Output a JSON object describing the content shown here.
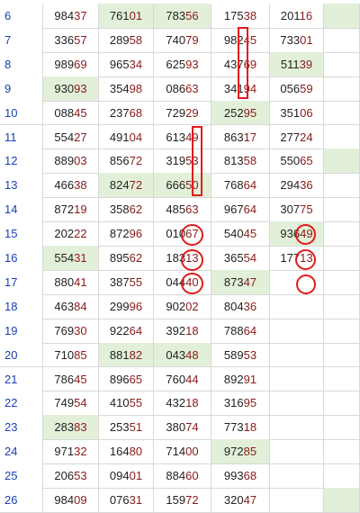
{
  "colors": {
    "highlight": "#e2f0d9",
    "row_number": "#1a3fb0",
    "last_two_digits": "#8b1a1a",
    "annotation": "#e21b1b"
  },
  "rows": [
    {
      "num": "6",
      "cells": [
        [
          "984",
          "37"
        ],
        [
          "761",
          "01"
        ],
        [
          "783",
          "56"
        ],
        [
          "175",
          "38"
        ],
        [
          "201",
          "16"
        ],
        [
          "",
          ""
        ]
      ],
      "hl": [
        1,
        2,
        5
      ]
    },
    {
      "num": "7",
      "cells": [
        [
          "336",
          "57"
        ],
        [
          "289",
          "58"
        ],
        [
          "740",
          "79"
        ],
        [
          "982",
          "45"
        ],
        [
          "733",
          "01"
        ],
        [
          "",
          ""
        ]
      ],
      "hl": []
    },
    {
      "num": "8",
      "cells": [
        [
          "989",
          "69"
        ],
        [
          "965",
          "34"
        ],
        [
          "625",
          "93"
        ],
        [
          "437",
          "69"
        ],
        [
          "511",
          "39"
        ],
        [
          "",
          ""
        ]
      ],
      "hl": [
        4
      ]
    },
    {
      "num": "9",
      "cells": [
        [
          "930",
          "93"
        ],
        [
          "354",
          "98"
        ],
        [
          "086",
          "63"
        ],
        [
          "341",
          "94"
        ],
        [
          "056",
          "59"
        ],
        [
          "",
          ""
        ]
      ],
      "hl": [
        0
      ]
    },
    {
      "num": "10",
      "cells": [
        [
          "088",
          "45"
        ],
        [
          "237",
          "68"
        ],
        [
          "729",
          "29"
        ],
        [
          "252",
          "95"
        ],
        [
          "351",
          "06"
        ],
        [
          "",
          ""
        ]
      ],
      "hl": [
        3
      ]
    },
    {
      "num": "11",
      "cells": [
        [
          "554",
          "27"
        ],
        [
          "491",
          "04"
        ],
        [
          "613",
          "49"
        ],
        [
          "863",
          "17"
        ],
        [
          "277",
          "24"
        ],
        [
          "",
          ""
        ]
      ],
      "hl": []
    },
    {
      "num": "12",
      "cells": [
        [
          "889",
          "03"
        ],
        [
          "856",
          "72"
        ],
        [
          "319",
          "53"
        ],
        [
          "813",
          "58"
        ],
        [
          "550",
          "65"
        ],
        [
          "",
          ""
        ]
      ],
      "hl": [
        5
      ]
    },
    {
      "num": "13",
      "cells": [
        [
          "466",
          "38"
        ],
        [
          "824",
          "72"
        ],
        [
          "666",
          "50"
        ],
        [
          "768",
          "64"
        ],
        [
          "294",
          "36"
        ],
        [
          "",
          ""
        ]
      ],
      "hl": [
        1,
        2
      ]
    },
    {
      "num": "14",
      "cells": [
        [
          "872",
          "19"
        ],
        [
          "358",
          "62"
        ],
        [
          "485",
          "63"
        ],
        [
          "967",
          "64"
        ],
        [
          "307",
          "75"
        ],
        [
          "",
          ""
        ]
      ],
      "hl": []
    },
    {
      "num": "15",
      "cells": [
        [
          "202",
          "22"
        ],
        [
          "872",
          "96"
        ],
        [
          "010",
          "67"
        ],
        [
          "540",
          "45"
        ],
        [
          "936",
          "49"
        ],
        [
          "",
          ""
        ]
      ],
      "hl": [
        4
      ]
    },
    {
      "num": "16",
      "cells": [
        [
          "554",
          "31"
        ],
        [
          "895",
          "62"
        ],
        [
          "183",
          "13"
        ],
        [
          "365",
          "54"
        ],
        [
          "177",
          "13"
        ],
        [
          "",
          ""
        ]
      ],
      "hl": [
        0
      ]
    },
    {
      "num": "17",
      "cells": [
        [
          "880",
          "41"
        ],
        [
          "387",
          "55"
        ],
        [
          "044",
          "40"
        ],
        [
          "873",
          "47"
        ],
        [
          "",
          ""
        ],
        [
          "",
          ""
        ]
      ],
      "hl": [
        3
      ]
    },
    {
      "num": "18",
      "cells": [
        [
          "463",
          "84"
        ],
        [
          "299",
          "96"
        ],
        [
          "902",
          "02"
        ],
        [
          "804",
          "36"
        ],
        [
          "",
          ""
        ],
        [
          "",
          ""
        ]
      ],
      "hl": []
    },
    {
      "num": "19",
      "cells": [
        [
          "769",
          "30"
        ],
        [
          "922",
          "64"
        ],
        [
          "392",
          "18"
        ],
        [
          "788",
          "64"
        ],
        [
          "",
          ""
        ],
        [
          "",
          ""
        ]
      ],
      "hl": []
    },
    {
      "num": "20",
      "cells": [
        [
          "710",
          "85"
        ],
        [
          "881",
          "82"
        ],
        [
          "043",
          "48"
        ],
        [
          "589",
          "53"
        ],
        [
          "",
          ""
        ],
        [
          "",
          ""
        ]
      ],
      "hl": [
        1,
        2
      ]
    },
    {
      "num": "21",
      "cells": [
        [
          "786",
          "45"
        ],
        [
          "896",
          "65"
        ],
        [
          "760",
          "44"
        ],
        [
          "892",
          "91"
        ],
        [
          "",
          ""
        ],
        [
          "",
          ""
        ]
      ],
      "hl": []
    },
    {
      "num": "22",
      "cells": [
        [
          "749",
          "54"
        ],
        [
          "410",
          "55"
        ],
        [
          "432",
          "18"
        ],
        [
          "316",
          "95"
        ],
        [
          "",
          ""
        ],
        [
          "",
          ""
        ]
      ],
      "hl": []
    },
    {
      "num": "23",
      "cells": [
        [
          "283",
          "83"
        ],
        [
          "253",
          "51"
        ],
        [
          "380",
          "74"
        ],
        [
          "773",
          "18"
        ],
        [
          "",
          ""
        ],
        [
          "",
          ""
        ]
      ],
      "hl": [
        0
      ]
    },
    {
      "num": "24",
      "cells": [
        [
          "971",
          "32"
        ],
        [
          "164",
          "80"
        ],
        [
          "714",
          "00"
        ],
        [
          "972",
          "85"
        ],
        [
          "",
          ""
        ],
        [
          "",
          ""
        ]
      ],
      "hl": [
        3
      ]
    },
    {
      "num": "25",
      "cells": [
        [
          "206",
          "53"
        ],
        [
          "094",
          "01"
        ],
        [
          "884",
          "60"
        ],
        [
          "993",
          "68"
        ],
        [
          "",
          ""
        ],
        [
          "",
          ""
        ]
      ],
      "hl": []
    },
    {
      "num": "26",
      "cells": [
        [
          "984",
          "09"
        ],
        [
          "076",
          "31"
        ],
        [
          "159",
          "72"
        ],
        [
          "320",
          "47"
        ],
        [
          "",
          ""
        ],
        [
          "",
          ""
        ]
      ],
      "hl": [
        5
      ]
    }
  ]
}
